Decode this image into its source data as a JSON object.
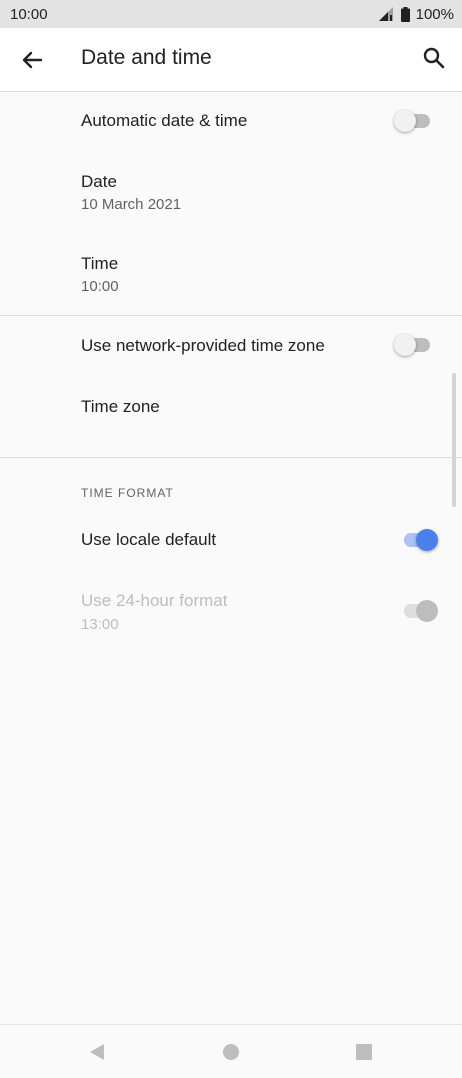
{
  "status_bar": {
    "time": "10:00",
    "battery": "100%"
  },
  "app_bar": {
    "title": "Date and time"
  },
  "settings": {
    "auto_datetime": {
      "label": "Automatic date & time",
      "enabled": false
    },
    "date": {
      "label": "Date",
      "value": "10 March 2021"
    },
    "time": {
      "label": "Time",
      "value": "10:00"
    },
    "network_timezone": {
      "label": "Use network-provided time zone",
      "enabled": false
    },
    "timezone": {
      "label": "Time zone"
    },
    "time_format_header": "TIME FORMAT",
    "locale_default": {
      "label": "Use locale default",
      "enabled": true
    },
    "hour24": {
      "label": "Use 24-hour format",
      "value": "13:00",
      "enabled": true,
      "disabled": true
    }
  },
  "colors": {
    "accent": "#4a80ea",
    "accent_track": "#aac2f5",
    "status_bar": "#e3e3e3"
  },
  "icons": [
    "back-arrow-icon",
    "search-icon",
    "signal-icon",
    "battery-icon",
    "nav-back-icon",
    "nav-home-icon",
    "nav-recents-icon"
  ]
}
